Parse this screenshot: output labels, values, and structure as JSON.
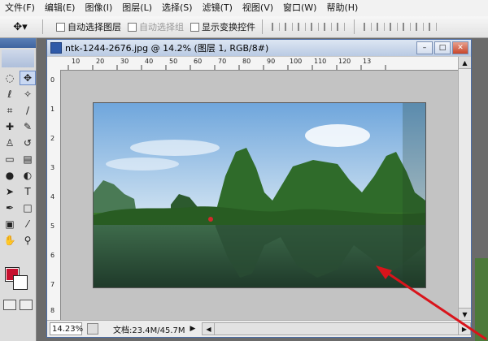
{
  "menu": [
    "文件(F)",
    "编辑(E)",
    "图像(I)",
    "图层(L)",
    "选择(S)",
    "滤镜(T)",
    "视图(V)",
    "窗口(W)",
    "帮助(H)"
  ],
  "options": {
    "tool_preset_icon": "move-tool-icon",
    "auto_select_layer": "自动选择图层",
    "auto_select_group": "自动选择组",
    "show_transform": "显示变换控件"
  },
  "document": {
    "title": "ntk-1244-2676.jpg @ 14.2% (图层 1, RGB/8#)",
    "zoom": "14.23%",
    "doc_size": "文档:23.4M/45.7M",
    "ruler_h_labels": [
      "10",
      "20",
      "30",
      "40",
      "50",
      "60",
      "70",
      "80",
      "90",
      "100",
      "110",
      "120",
      "13"
    ],
    "ruler_v_labels": [
      "0",
      "1",
      "2",
      "3",
      "4",
      "5",
      "6",
      "7",
      "8"
    ]
  },
  "colors": {
    "foreground": "#c6102e",
    "background": "#ffffff",
    "annotation": "#d9141b"
  }
}
